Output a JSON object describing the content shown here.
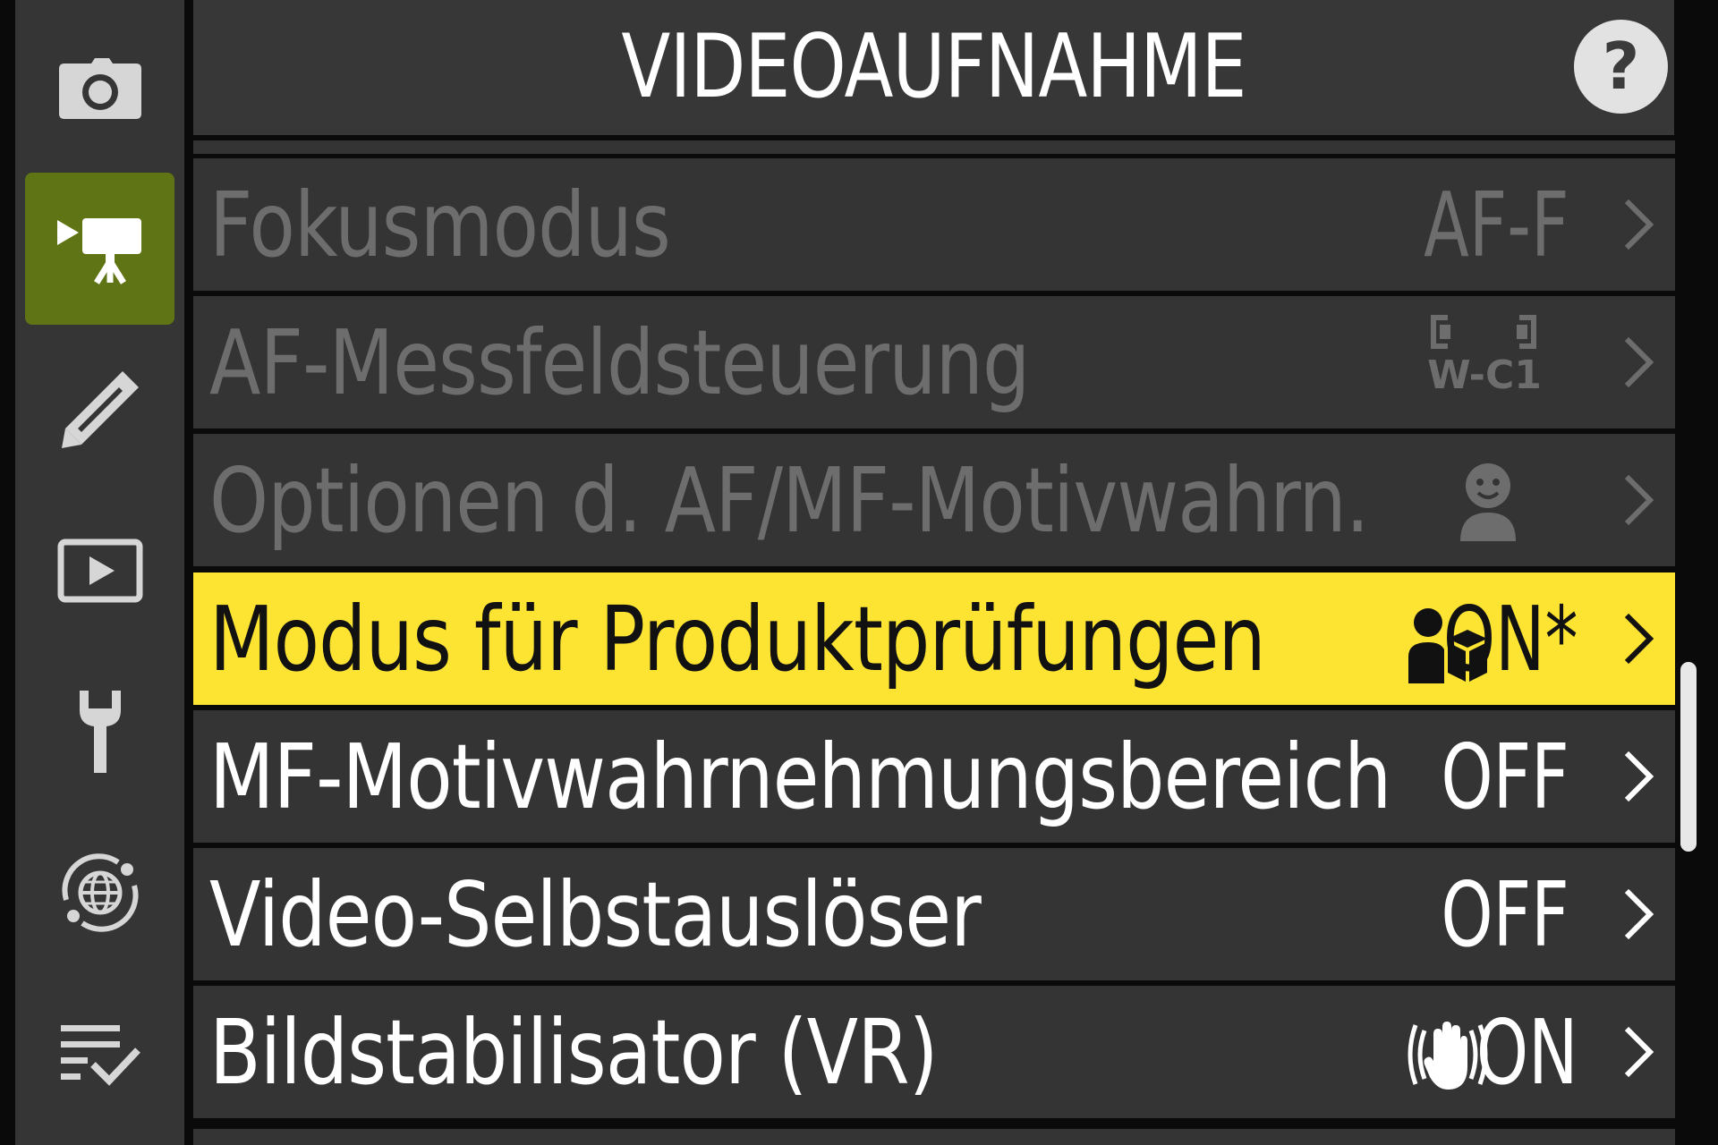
{
  "header": {
    "title": "VIDEOAUFNAHME",
    "help_label": "?"
  },
  "sidebar": {
    "tabs": [
      {
        "icon": "camera-icon",
        "active": false
      },
      {
        "icon": "movie-camera-icon",
        "active": true
      },
      {
        "icon": "pencil-icon",
        "active": false
      },
      {
        "icon": "playback-icon",
        "active": false
      },
      {
        "icon": "wrench-icon",
        "active": false
      },
      {
        "icon": "network-icon",
        "active": false
      },
      {
        "icon": "my-menu-icon",
        "active": false
      }
    ]
  },
  "menu": {
    "items": [
      {
        "label": "Fokusmodus",
        "value": "AF-F",
        "enabled": false
      },
      {
        "label": "AF-Messfeldsteuerung",
        "value": "W-C1",
        "value_icon": "wide-area-af-icon",
        "enabled": false
      },
      {
        "label": "Optionen d. AF/MF-Motivwahrn.",
        "value_icon": "face-detection-icon",
        "enabled": false
      },
      {
        "label": "Modus für Produktprüfungen",
        "value": "ON*",
        "value_icon": "product-review-icon",
        "selected": true
      },
      {
        "label": "MF-Motivwahrnehmungsbereich",
        "value": "OFF"
      },
      {
        "label": "Video-Selbstauslöser",
        "value": "OFF"
      },
      {
        "label": "Bildstabilisator (VR)",
        "value": "ON",
        "value_icon": "vibration-reduction-hand-icon"
      }
    ]
  },
  "colors": {
    "accent": "#fde432",
    "active_tab": "#5f7414",
    "background": "#0a0a0a",
    "row": "#343434"
  }
}
